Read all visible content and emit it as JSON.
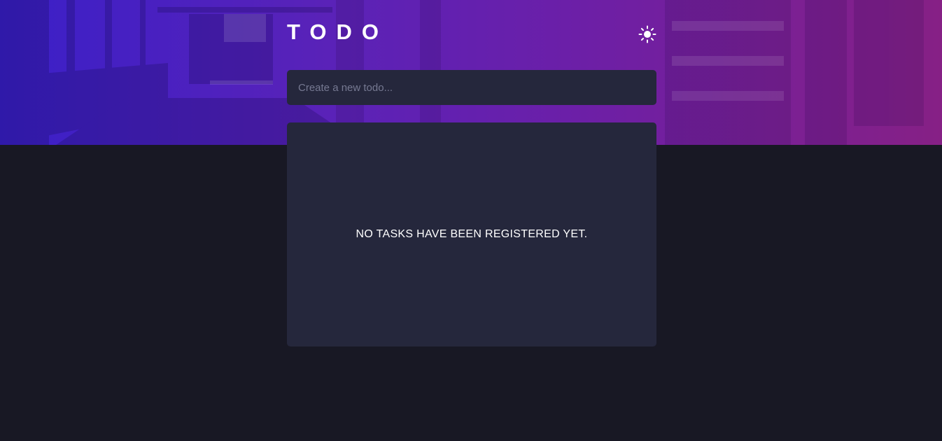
{
  "app": {
    "title": "TODO"
  },
  "theme_toggle": {
    "icon": "sun-icon"
  },
  "new_todo": {
    "placeholder": "Create a new todo...",
    "value": ""
  },
  "list": {
    "empty_message": "NO TASKS HAVE BEEN REGISTERED YET."
  },
  "colors": {
    "page_background": "#181824",
    "card_background": "#25273c",
    "hero_gradient_start": "#3a1fc8",
    "hero_gradient_end": "#862085",
    "text_primary": "#ffffff",
    "placeholder": "#767992"
  }
}
